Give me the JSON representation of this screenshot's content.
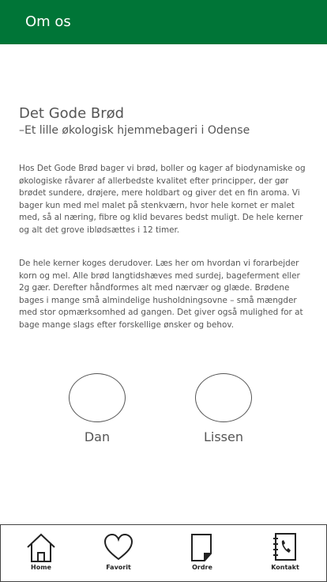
{
  "header": {
    "title": "Om os"
  },
  "main": {
    "heading": "Det Gode Brød",
    "subheading": "–Et lille økologisk hjemmebageri i Odense",
    "paragraph1": "Hos Det Gode Brød bager vi brød, boller og kager af biodynamiske og økologiske råvarer af allerbedste kvalitet efter principper, der gør brødet sundere, drøjere, mere holdbart og giver det en fin aroma. Vi bager kun med mel malet på stenkværn, hvor hele kornet er malet med, så al næring, fibre og klid bevares bedst muligt. De hele kerner og alt det grove iblødsættes i 12 timer.",
    "paragraph2": "De hele kerner koges derudover. Læs her om hvordan vi forarbejder korn og mel. Alle brød langtidshæves med surdej, bageferment eller 2g gær. Derefter håndformes alt med nærvær og glæde. Brødene bages i mange små almindelige husholdningsovne – små mængder med stor opmærksomhed ad gangen. Det giver også mulighed for at bage mange slags efter forskellige ønsker og behov.",
    "people": [
      {
        "name": "Dan"
      },
      {
        "name": "Lissen"
      }
    ]
  },
  "nav": {
    "items": [
      {
        "label": "Home",
        "icon": "home-icon"
      },
      {
        "label": "Favorit",
        "icon": "heart-icon"
      },
      {
        "label": "Ordre",
        "icon": "order-note-icon"
      },
      {
        "label": "Kontakt",
        "icon": "contact-book-icon"
      }
    ]
  },
  "colors": {
    "header_bg": "#007537",
    "text": "#555555"
  }
}
